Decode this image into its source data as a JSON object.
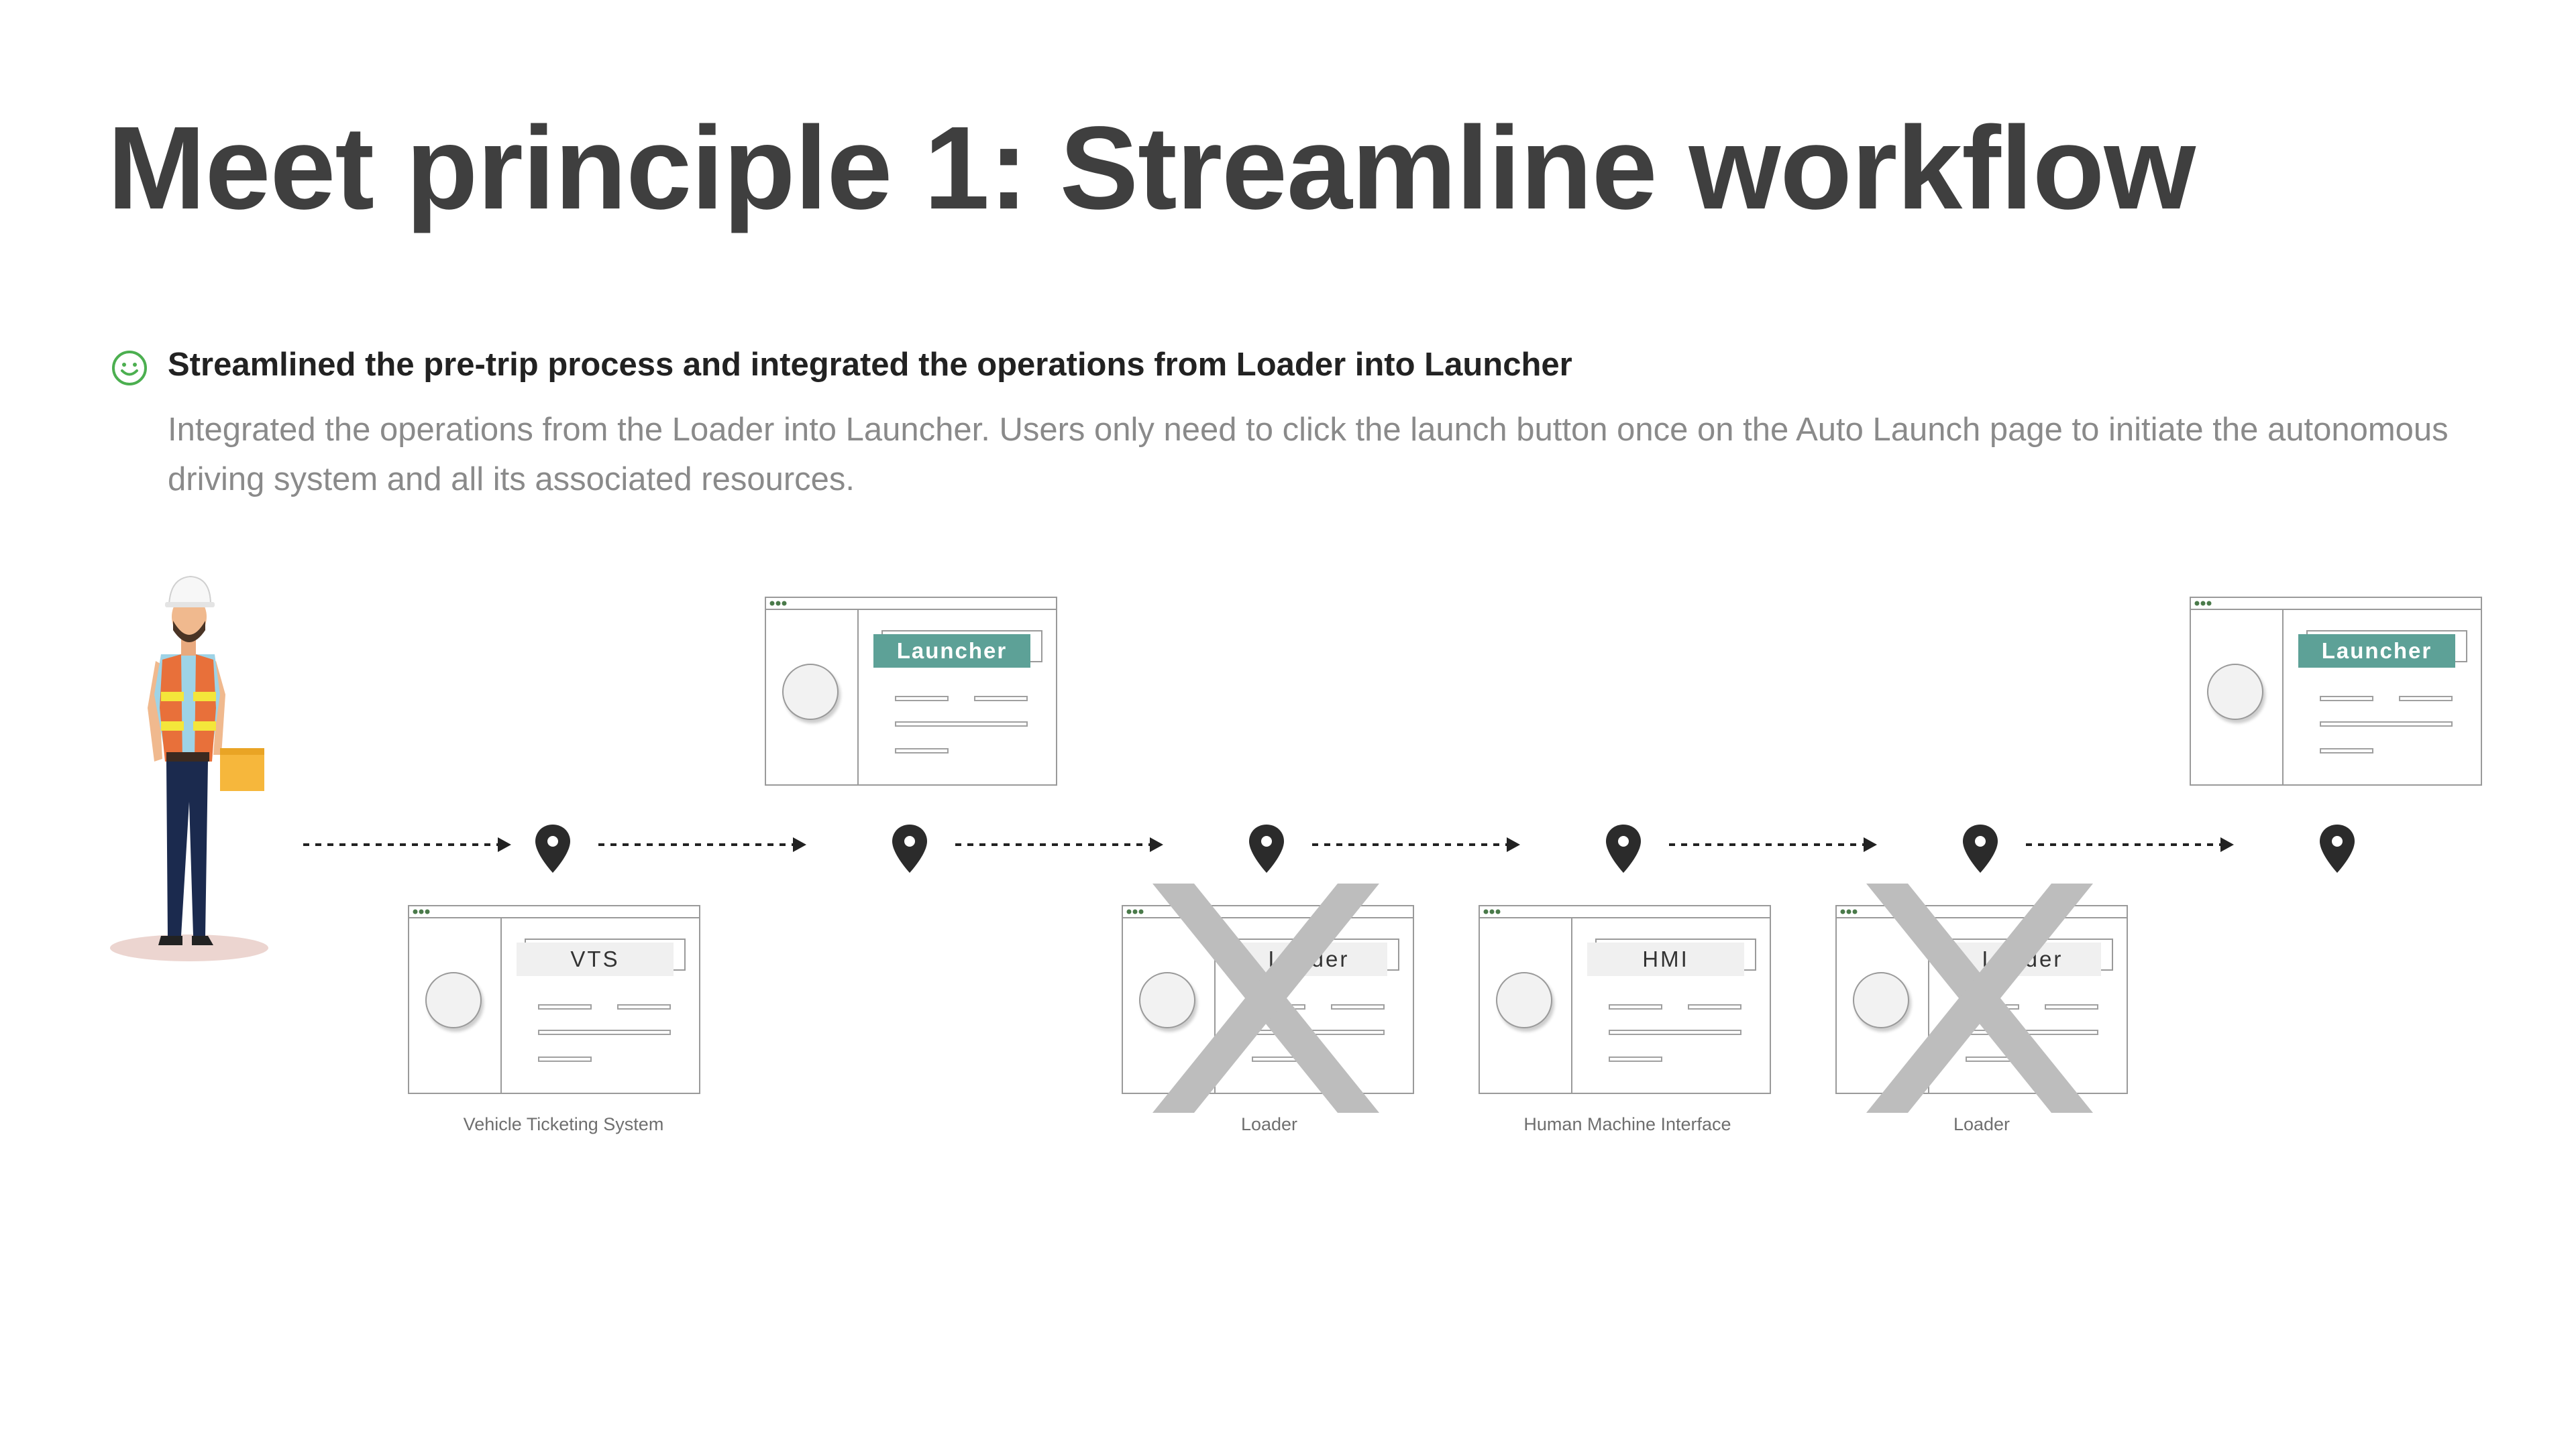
{
  "title": "Meet principle 1: Streamline workflow",
  "principle": {
    "icon": "smiley-face-icon",
    "heading": "Streamlined the pre-trip process and integrated the operations from Loader into Launcher",
    "description": "Integrated the operations from the Loader into Launcher. Users only need to click the launch button once on the Auto Launch page to initiate the autonomous driving system and all its associated resources."
  },
  "flow": {
    "steps": [
      {
        "window_label": "VTS",
        "caption": "Vehicle Ticketing System",
        "removed": false
      },
      {
        "window_label": "Launcher",
        "caption": "",
        "removed": false
      },
      {
        "window_label": "Loader",
        "caption": "Loader",
        "removed": true
      },
      {
        "window_label": "HMI",
        "caption": "Human Machine Interface",
        "removed": false
      },
      {
        "window_label": "Loader",
        "caption": "Loader",
        "removed": true
      },
      {
        "window_label": "Launcher",
        "caption": "",
        "removed": false
      }
    ]
  },
  "colors": {
    "title": "#3f3f3f",
    "accent_green": "#5da197",
    "smiley_green": "#4caf50",
    "cross_grey": "#bdbdbd"
  }
}
